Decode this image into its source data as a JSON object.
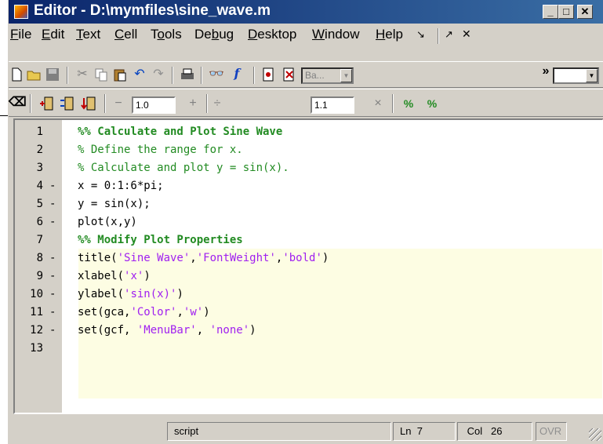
{
  "window": {
    "title": "Editor - D:\\mymfiles\\sine_wave.m"
  },
  "title_buttons": {
    "minimize": "_",
    "maximize": "□",
    "close": "✕"
  },
  "menu": [
    {
      "label": "File"
    },
    {
      "label": "Edit"
    },
    {
      "label": "Text"
    },
    {
      "label": "Cell"
    },
    {
      "label": "Tools"
    },
    {
      "label": "Debug"
    },
    {
      "label": "Desktop"
    },
    {
      "label": "Window"
    },
    {
      "label": "Help"
    }
  ],
  "menu_controls": {
    "undock": "↘",
    "dock": "↗",
    "close": "✕"
  },
  "toolbar": {
    "stack_label": "Ba...",
    "f_label": "f",
    "overflow": "»"
  },
  "cell_toolbar": {
    "decrement": "−",
    "value1": "1.0",
    "increment": "+",
    "divide": "÷",
    "value2": "1.1",
    "multiply": "×"
  },
  "code_lines": [
    {
      "n": "1",
      "dash": "",
      "segments": [
        {
          "t": "%% Calculate and Plot Sine Wave",
          "c": "cellhead"
        }
      ]
    },
    {
      "n": "2",
      "dash": "",
      "segments": [
        {
          "t": "% Define the range for x.",
          "c": "comment"
        }
      ]
    },
    {
      "n": "3",
      "dash": "",
      "segments": [
        {
          "t": "% Calculate and plot y = sin(x).",
          "c": "comment"
        }
      ]
    },
    {
      "n": "4",
      "dash": "-",
      "segments": [
        {
          "t": "x = 0:1:6*pi;",
          "c": "code"
        }
      ]
    },
    {
      "n": "5",
      "dash": "-",
      "segments": [
        {
          "t": "y = sin(x);",
          "c": "code"
        }
      ]
    },
    {
      "n": "6",
      "dash": "-",
      "segments": [
        {
          "t": "plot(x,y)",
          "c": "code"
        }
      ]
    },
    {
      "n": "7",
      "dash": "",
      "segments": [
        {
          "t": "%% Modify Plot Properties",
          "c": "cellhead"
        }
      ]
    },
    {
      "n": "8",
      "dash": "-",
      "segments": [
        {
          "t": "title(",
          "c": "code"
        },
        {
          "t": "'Sine Wave'",
          "c": "string"
        },
        {
          "t": ",",
          "c": "code"
        },
        {
          "t": "'FontWeight'",
          "c": "string"
        },
        {
          "t": ",",
          "c": "code"
        },
        {
          "t": "'bold'",
          "c": "string"
        },
        {
          "t": ")",
          "c": "code"
        }
      ]
    },
    {
      "n": "9",
      "dash": "-",
      "segments": [
        {
          "t": "xlabel(",
          "c": "code"
        },
        {
          "t": "'x'",
          "c": "string"
        },
        {
          "t": ")",
          "c": "code"
        }
      ]
    },
    {
      "n": "10",
      "dash": "-",
      "segments": [
        {
          "t": "ylabel(",
          "c": "code"
        },
        {
          "t": "'sin(x)'",
          "c": "string"
        },
        {
          "t": ")",
          "c": "code"
        }
      ]
    },
    {
      "n": "11",
      "dash": "-",
      "segments": [
        {
          "t": "set(gca,",
          "c": "code"
        },
        {
          "t": "'Color'",
          "c": "string"
        },
        {
          "t": ",",
          "c": "code"
        },
        {
          "t": "'w'",
          "c": "string"
        },
        {
          "t": ")",
          "c": "code"
        }
      ]
    },
    {
      "n": "12",
      "dash": "-",
      "segments": [
        {
          "t": "set(gcf, ",
          "c": "code"
        },
        {
          "t": "'MenuBar'",
          "c": "string"
        },
        {
          "t": ", ",
          "c": "code"
        },
        {
          "t": "'none'",
          "c": "string"
        },
        {
          "t": ")",
          "c": "code"
        }
      ]
    },
    {
      "n": "13",
      "dash": "",
      "segments": []
    }
  ],
  "colors": {
    "cellhead": "#228b22",
    "comment": "#228b22",
    "code": "#000000",
    "string": "#a020f0",
    "cell_highlight": "#fdfde3"
  },
  "status": {
    "mode": "script",
    "ln_label": "Ln",
    "ln_value": "7",
    "col_label": "Col",
    "col_value": "26",
    "ovr": "OVR"
  }
}
